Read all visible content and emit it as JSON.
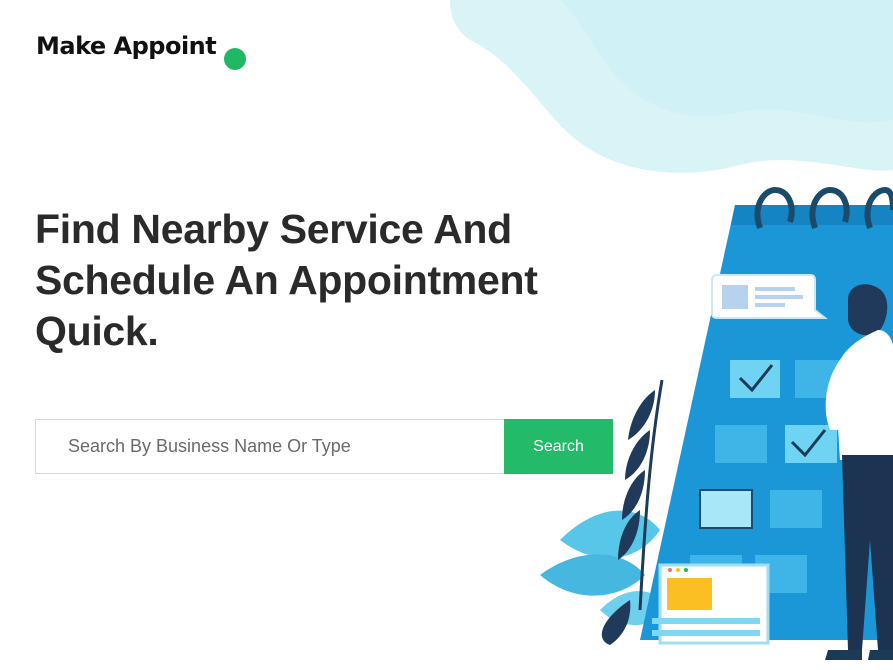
{
  "brand": {
    "name": "Make Appoint"
  },
  "hero": {
    "headline_lines": [
      "Find Nearby Service And",
      "Schedule An Appointment",
      "Quick."
    ]
  },
  "search": {
    "placeholder": "Search By Business Name Or Type",
    "value": "",
    "button_label": "Search"
  },
  "colors": {
    "accent": "#23bb6a",
    "calendar_blue": "#1b97d8",
    "blob": "#d9f4f7"
  },
  "icons": [
    "brand-dot-icon",
    "calendar-illustration",
    "check-icon",
    "person-illustration",
    "plant-illustration"
  ]
}
